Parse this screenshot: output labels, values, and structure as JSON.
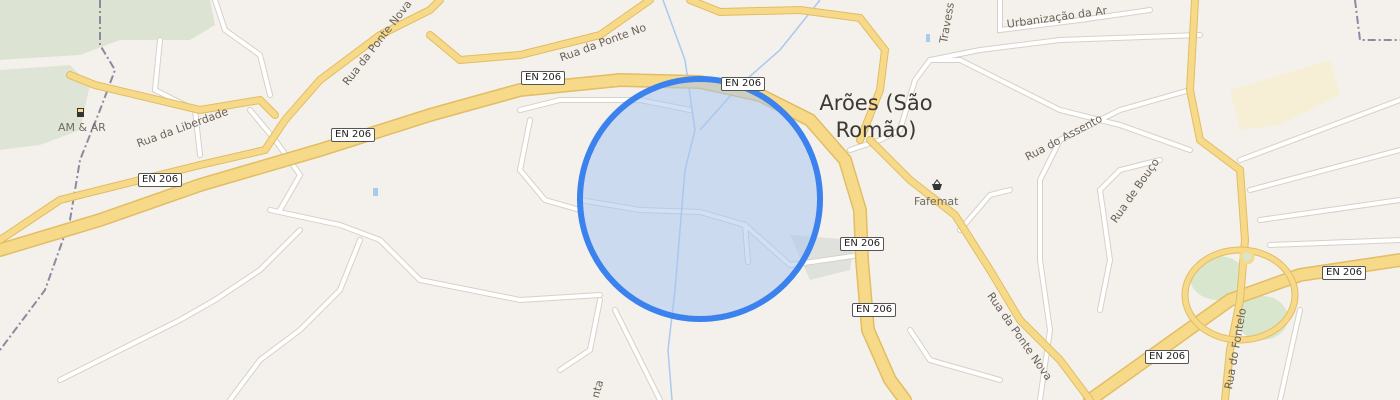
{
  "colors": {
    "background": "#f4f1ec",
    "major_road_fill": "#f7d98a",
    "major_road_casing": "#e2bd62",
    "minor_road": "#ffffff",
    "minor_road_casing": "#d6d1c8",
    "water": "#a9c9ee",
    "park": "#dde8d3",
    "circle_fill": "#a9c6f0",
    "circle_stroke": "#3b82ef",
    "boundary": "#8a8aa0"
  },
  "place": {
    "line1": "Arões (São",
    "line2": "Romão)"
  },
  "pois": {
    "am_ar": "AM & AR",
    "fafemat": "Fafemat"
  },
  "roads": {
    "rua_ponte_nova_top": "Rua da Ponte Nova",
    "rua_ponte_nova_right": "Rua da Ponte Nova",
    "rua_ponte_nova_truncated": "Rua da Ponte No",
    "rua_liberdade": "Rua da Liberdade",
    "urbanizacao": "Urbanização da Ar",
    "travess": "Travess",
    "rua_assento": "Rua do Assento",
    "rua_bouco": "Rua de Bouço",
    "rua_fontelo": "Rua do Fontelo",
    "partial_nta": "nta"
  },
  "shields": [
    "EN 206",
    "EN 206",
    "EN 206",
    "EN 206",
    "EN 206",
    "EN 206",
    "EN 206",
    "EN 206"
  ],
  "icons": {
    "fuel": "fuel-icon",
    "shop": "shopping-basket-icon"
  }
}
